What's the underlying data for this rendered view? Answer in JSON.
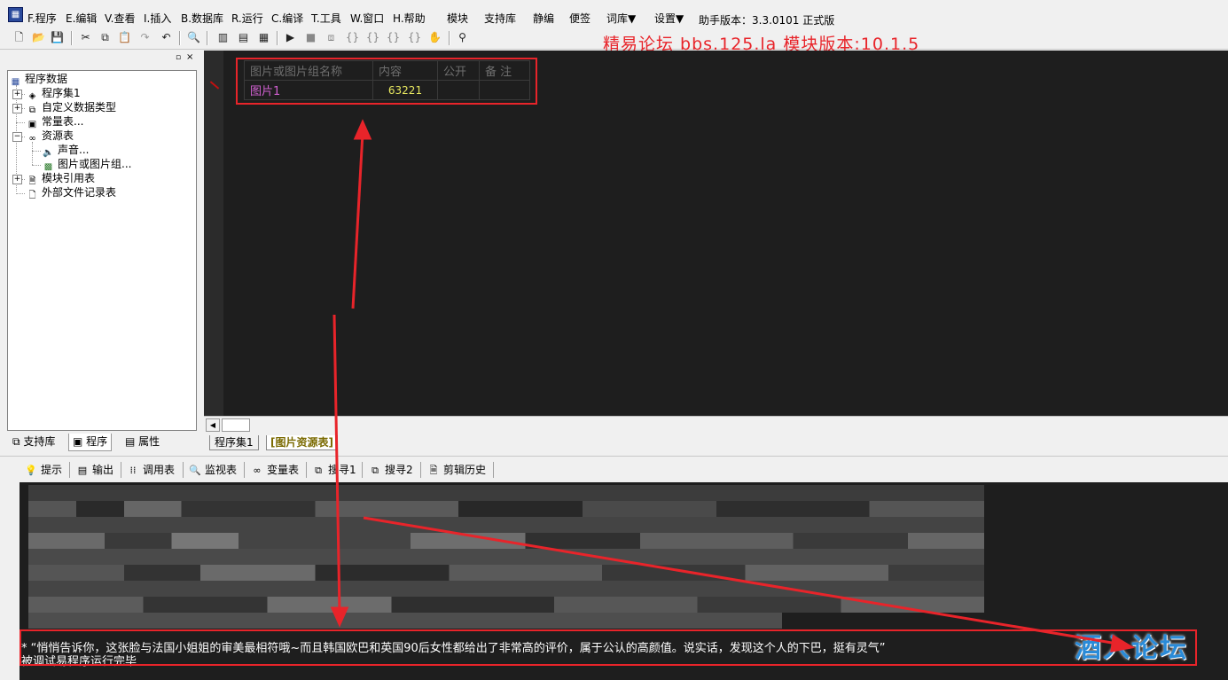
{
  "menu": {
    "items": [
      "F.程序",
      "E.编辑",
      "V.查看",
      "I.插入",
      "B.数据库",
      "R.运行",
      "C.编译",
      "T.工具",
      "W.窗口",
      "H.帮助",
      "模块",
      "支持库",
      "静编",
      "便签",
      "词库▼",
      "设置▼"
    ],
    "helper_version": "助手版本：3.3.0101 正式版"
  },
  "banner": "精易论坛 bbs.125.la 模块版本:10.1.5",
  "tree": {
    "root": "程序数据",
    "nodes": [
      "程序集1",
      "自定义数据类型",
      "常量表...",
      "资源表",
      "声音...",
      "图片或图片组...",
      "模块引用表",
      "外部文件记录表"
    ]
  },
  "panel_tabs": [
    "支持库",
    "程序",
    "属性"
  ],
  "resource_table": {
    "headers": [
      "图片或图片组名称",
      "内容",
      "公开",
      "备 注"
    ],
    "rows": [
      [
        "图片1",
        "63221",
        "",
        ""
      ]
    ]
  },
  "doc_tabs": [
    "程序集1",
    "[图片资源表]"
  ],
  "bottom_tabs": [
    "提示",
    "输出",
    "调用表",
    "监视表",
    "变量表",
    "搜寻1",
    "搜寻2",
    "剪辑历史"
  ],
  "output": {
    "line1": "*  “悄悄告诉你，这张脸与法国小姐姐的审美最相符哦~而且韩国欧巴和英国90后女性都给出了非常高的评价，属于公认的高颜值。说实话，发现这个人的下巴，挺有灵气”",
    "line2": "被调试易程序运行完毕"
  },
  "watermark": "酒入论坛",
  "colors": {
    "annotation_red": "#e8242a",
    "editor_bg": "#1e1e1e",
    "resource_name": "#d060d0",
    "resource_value": "#e8e860"
  }
}
